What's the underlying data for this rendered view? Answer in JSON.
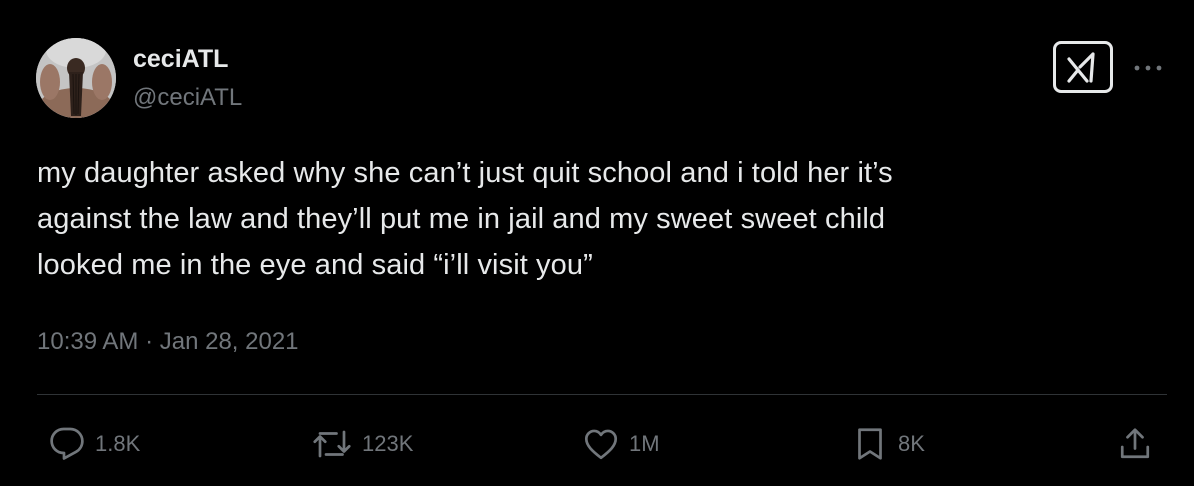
{
  "author": {
    "display_name": "ceciATL",
    "handle": "@ceciATL"
  },
  "tweet": {
    "text": "my daughter asked why she can’t just quit school and i told her it’s\nagainst the law and they’ll put me in jail and my sweet sweet child\nlooked me in the eye and said “i’ll visit you”",
    "timestamp": "10:39 AM · Jan 28, 2021"
  },
  "actions": {
    "replies": "1.8K",
    "reposts": "123K",
    "likes": "1M",
    "bookmarks": "8K"
  },
  "colors": {
    "background": "#000000",
    "primary_text": "#e7e9ea",
    "secondary_text": "#71767b",
    "divider": "#2f3336"
  },
  "icons": {
    "grok": "grok-icon",
    "more": "more-icon",
    "reply": "reply-icon",
    "repost": "repost-icon",
    "like": "heart-icon",
    "bookmark": "bookmark-icon",
    "share": "share-icon"
  }
}
